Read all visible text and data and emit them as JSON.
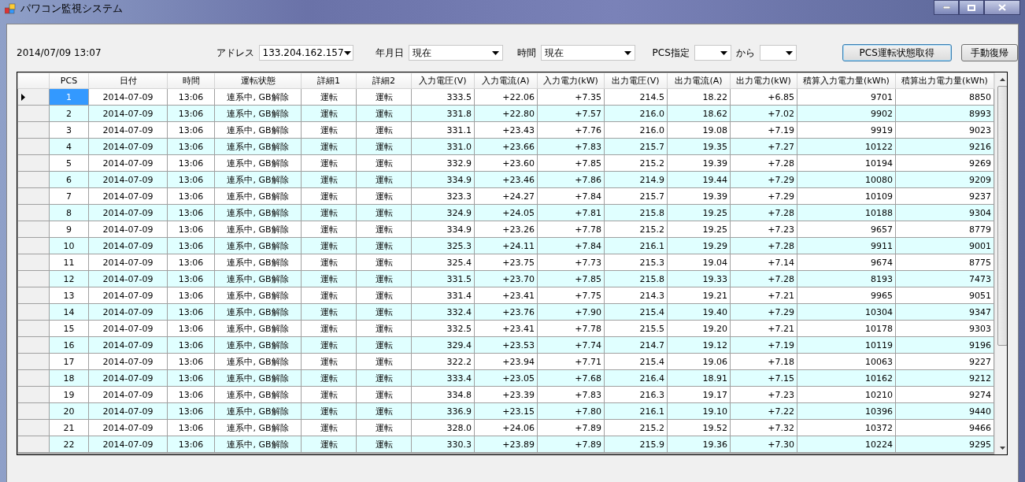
{
  "window": {
    "title": "パワコン監視システム"
  },
  "toolbar": {
    "datetime": "2014/07/09 13:07",
    "fields": [
      {
        "label": "アドレス",
        "value": "133.204.162.157",
        "kind": "wide"
      },
      {
        "label": "年月日",
        "value": "現在",
        "kind": "wide"
      },
      {
        "label": "時間",
        "value": "現在",
        "kind": "wide"
      },
      {
        "label": "PCS指定",
        "kind": "narrow"
      },
      {
        "label": "から",
        "kind": "narrow"
      }
    ],
    "buttons": [
      {
        "label": "PCS運転状態取得",
        "kind": "default"
      },
      {
        "label": "手動復帰",
        "kind": "normal"
      }
    ]
  },
  "table": {
    "columns": [
      {
        "label": "PCS",
        "kind": "text"
      },
      {
        "label": "日付",
        "kind": "text"
      },
      {
        "label": "時間",
        "kind": "text"
      },
      {
        "label": "運転状態",
        "kind": "text"
      },
      {
        "label": "詳細1",
        "kind": "text"
      },
      {
        "label": "詳細2",
        "kind": "text"
      },
      {
        "label": "入力電圧(V)",
        "kind": "number"
      },
      {
        "label": "入力電流(A)",
        "kind": "number"
      },
      {
        "label": "入力電力(kW)",
        "kind": "number"
      },
      {
        "label": "出力電圧(V)",
        "kind": "number"
      },
      {
        "label": "出力電流(A)",
        "kind": "number"
      },
      {
        "label": "出力電力(kW)",
        "kind": "number"
      },
      {
        "label": "積算入力電力量(kWh)",
        "kind": "number"
      },
      {
        "label": "積算出力電力量(kWh)",
        "kind": "number"
      }
    ],
    "rows": [
      {
        "selected": true,
        "cells": [
          "1",
          "2014-07-09",
          "13:06",
          "連系中, GB解除",
          "運転",
          "運転",
          "333.5",
          "+22.06",
          "+7.35",
          "214.5",
          "18.22",
          "+6.85",
          "9701",
          "8850"
        ]
      },
      {
        "selected": false,
        "cells": [
          "2",
          "2014-07-09",
          "13:06",
          "連系中, GB解除",
          "運転",
          "運転",
          "331.8",
          "+22.80",
          "+7.57",
          "216.0",
          "18.62",
          "+7.02",
          "9902",
          "8993"
        ]
      },
      {
        "selected": false,
        "cells": [
          "3",
          "2014-07-09",
          "13:06",
          "連系中, GB解除",
          "運転",
          "運転",
          "331.1",
          "+23.43",
          "+7.76",
          "216.0",
          "19.08",
          "+7.19",
          "9919",
          "9023"
        ]
      },
      {
        "selected": false,
        "cells": [
          "4",
          "2014-07-09",
          "13:06",
          "連系中, GB解除",
          "運転",
          "運転",
          "331.0",
          "+23.66",
          "+7.83",
          "215.7",
          "19.35",
          "+7.27",
          "10122",
          "9216"
        ]
      },
      {
        "selected": false,
        "cells": [
          "5",
          "2014-07-09",
          "13:06",
          "連系中, GB解除",
          "運転",
          "運転",
          "332.9",
          "+23.60",
          "+7.85",
          "215.2",
          "19.39",
          "+7.28",
          "10194",
          "9269"
        ]
      },
      {
        "selected": false,
        "cells": [
          "6",
          "2014-07-09",
          "13:06",
          "連系中, GB解除",
          "運転",
          "運転",
          "334.9",
          "+23.46",
          "+7.86",
          "214.9",
          "19.44",
          "+7.29",
          "10080",
          "9209"
        ]
      },
      {
        "selected": false,
        "cells": [
          "7",
          "2014-07-09",
          "13:06",
          "連系中, GB解除",
          "運転",
          "運転",
          "323.3",
          "+24.27",
          "+7.84",
          "215.7",
          "19.39",
          "+7.29",
          "10109",
          "9237"
        ]
      },
      {
        "selected": false,
        "cells": [
          "8",
          "2014-07-09",
          "13:06",
          "連系中, GB解除",
          "運転",
          "運転",
          "324.9",
          "+24.05",
          "+7.81",
          "215.8",
          "19.25",
          "+7.28",
          "10188",
          "9304"
        ]
      },
      {
        "selected": false,
        "cells": [
          "9",
          "2014-07-09",
          "13:06",
          "連系中, GB解除",
          "運転",
          "運転",
          "334.9",
          "+23.26",
          "+7.78",
          "215.2",
          "19.25",
          "+7.23",
          "9657",
          "8779"
        ]
      },
      {
        "selected": false,
        "cells": [
          "10",
          "2014-07-09",
          "13:06",
          "連系中, GB解除",
          "運転",
          "運転",
          "325.3",
          "+24.11",
          "+7.84",
          "216.1",
          "19.29",
          "+7.28",
          "9911",
          "9001"
        ]
      },
      {
        "selected": false,
        "cells": [
          "11",
          "2014-07-09",
          "13:06",
          "連系中, GB解除",
          "運転",
          "運転",
          "325.4",
          "+23.75",
          "+7.73",
          "215.3",
          "19.04",
          "+7.14",
          "9674",
          "8775"
        ]
      },
      {
        "selected": false,
        "cells": [
          "12",
          "2014-07-09",
          "13:06",
          "連系中, GB解除",
          "運転",
          "運転",
          "331.5",
          "+23.70",
          "+7.85",
          "215.8",
          "19.33",
          "+7.28",
          "8193",
          "7473"
        ]
      },
      {
        "selected": false,
        "cells": [
          "13",
          "2014-07-09",
          "13:06",
          "連系中, GB解除",
          "運転",
          "運転",
          "331.4",
          "+23.41",
          "+7.75",
          "214.3",
          "19.21",
          "+7.21",
          "9965",
          "9051"
        ]
      },
      {
        "selected": false,
        "cells": [
          "14",
          "2014-07-09",
          "13:06",
          "連系中, GB解除",
          "運転",
          "運転",
          "332.4",
          "+23.76",
          "+7.90",
          "215.4",
          "19.40",
          "+7.29",
          "10304",
          "9347"
        ]
      },
      {
        "selected": false,
        "cells": [
          "15",
          "2014-07-09",
          "13:06",
          "連系中, GB解除",
          "運転",
          "運転",
          "332.5",
          "+23.41",
          "+7.78",
          "215.5",
          "19.20",
          "+7.21",
          "10178",
          "9303"
        ]
      },
      {
        "selected": false,
        "cells": [
          "16",
          "2014-07-09",
          "13:06",
          "連系中, GB解除",
          "運転",
          "運転",
          "329.4",
          "+23.53",
          "+7.74",
          "214.7",
          "19.12",
          "+7.19",
          "10119",
          "9196"
        ]
      },
      {
        "selected": false,
        "cells": [
          "17",
          "2014-07-09",
          "13:06",
          "連系中, GB解除",
          "運転",
          "運転",
          "322.2",
          "+23.94",
          "+7.71",
          "215.4",
          "19.06",
          "+7.18",
          "10063",
          "9227"
        ]
      },
      {
        "selected": false,
        "cells": [
          "18",
          "2014-07-09",
          "13:06",
          "連系中, GB解除",
          "運転",
          "運転",
          "333.4",
          "+23.05",
          "+7.68",
          "216.4",
          "18.91",
          "+7.15",
          "10162",
          "9212"
        ]
      },
      {
        "selected": false,
        "cells": [
          "19",
          "2014-07-09",
          "13:06",
          "連系中, GB解除",
          "運転",
          "運転",
          "334.8",
          "+23.39",
          "+7.83",
          "216.3",
          "19.17",
          "+7.23",
          "10210",
          "9274"
        ]
      },
      {
        "selected": false,
        "cells": [
          "20",
          "2014-07-09",
          "13:06",
          "連系中, GB解除",
          "運転",
          "運転",
          "336.9",
          "+23.15",
          "+7.80",
          "216.1",
          "19.10",
          "+7.22",
          "10396",
          "9440"
        ]
      },
      {
        "selected": false,
        "cells": [
          "21",
          "2014-07-09",
          "13:06",
          "連系中, GB解除",
          "運転",
          "運転",
          "328.0",
          "+24.06",
          "+7.89",
          "215.2",
          "19.52",
          "+7.32",
          "10372",
          "9466"
        ]
      },
      {
        "selected": false,
        "cells": [
          "22",
          "2014-07-09",
          "13:06",
          "連系中, GB解除",
          "運転",
          "運転",
          "330.3",
          "+23.89",
          "+7.89",
          "215.9",
          "19.36",
          "+7.30",
          "10224",
          "9295"
        ]
      }
    ]
  }
}
